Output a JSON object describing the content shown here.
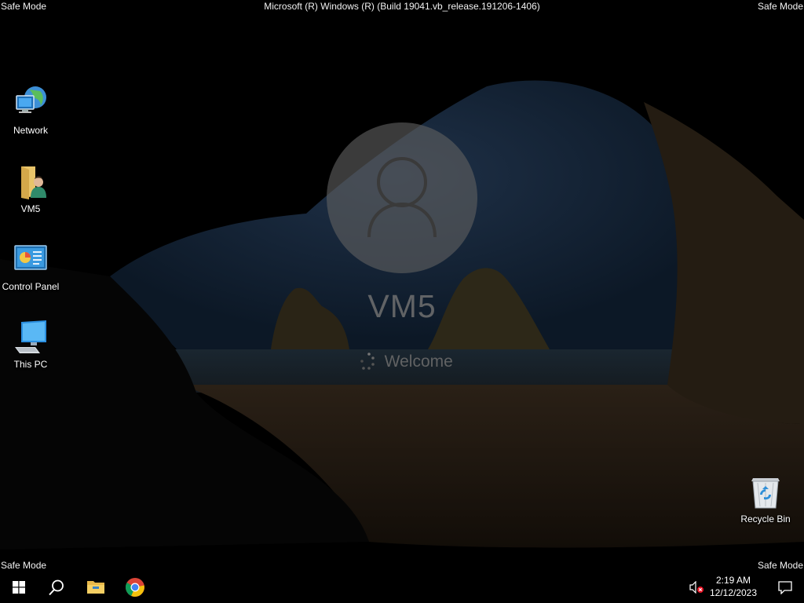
{
  "safe_mode": {
    "top_left": "Safe Mode",
    "top_right": "Safe Mode",
    "bottom_left": "Safe Mode",
    "bottom_right": "Safe Mode"
  },
  "build_text": "Microsoft (R) Windows (R) (Build 19041.vb_release.191206-1406)",
  "desktop_icons": [
    {
      "label": "Network",
      "icon": "network-icon"
    },
    {
      "label": "VM5",
      "icon": "user-folder-icon"
    },
    {
      "label": "Control Panel",
      "icon": "control-panel-icon"
    },
    {
      "label": "This PC",
      "icon": "this-pc-icon"
    },
    {
      "label": "Recycle Bin",
      "icon": "recycle-bin-icon"
    }
  ],
  "welcome_screen": {
    "user_name": "VM5",
    "status": "Welcome"
  },
  "taskbar": {
    "start_icon": "windows-start-icon",
    "search_icon": "search-icon",
    "pinned": [
      "file-explorer-icon",
      "chrome-icon"
    ],
    "tray": {
      "volume_icon": "volume-muted-icon",
      "time": "2:19 AM",
      "date": "12/12/2023",
      "notification_icon": "notification-icon"
    }
  },
  "colors": {
    "taskbar": "#000000",
    "avatar_circle": "#606060",
    "start_icon": "#ffffff"
  }
}
